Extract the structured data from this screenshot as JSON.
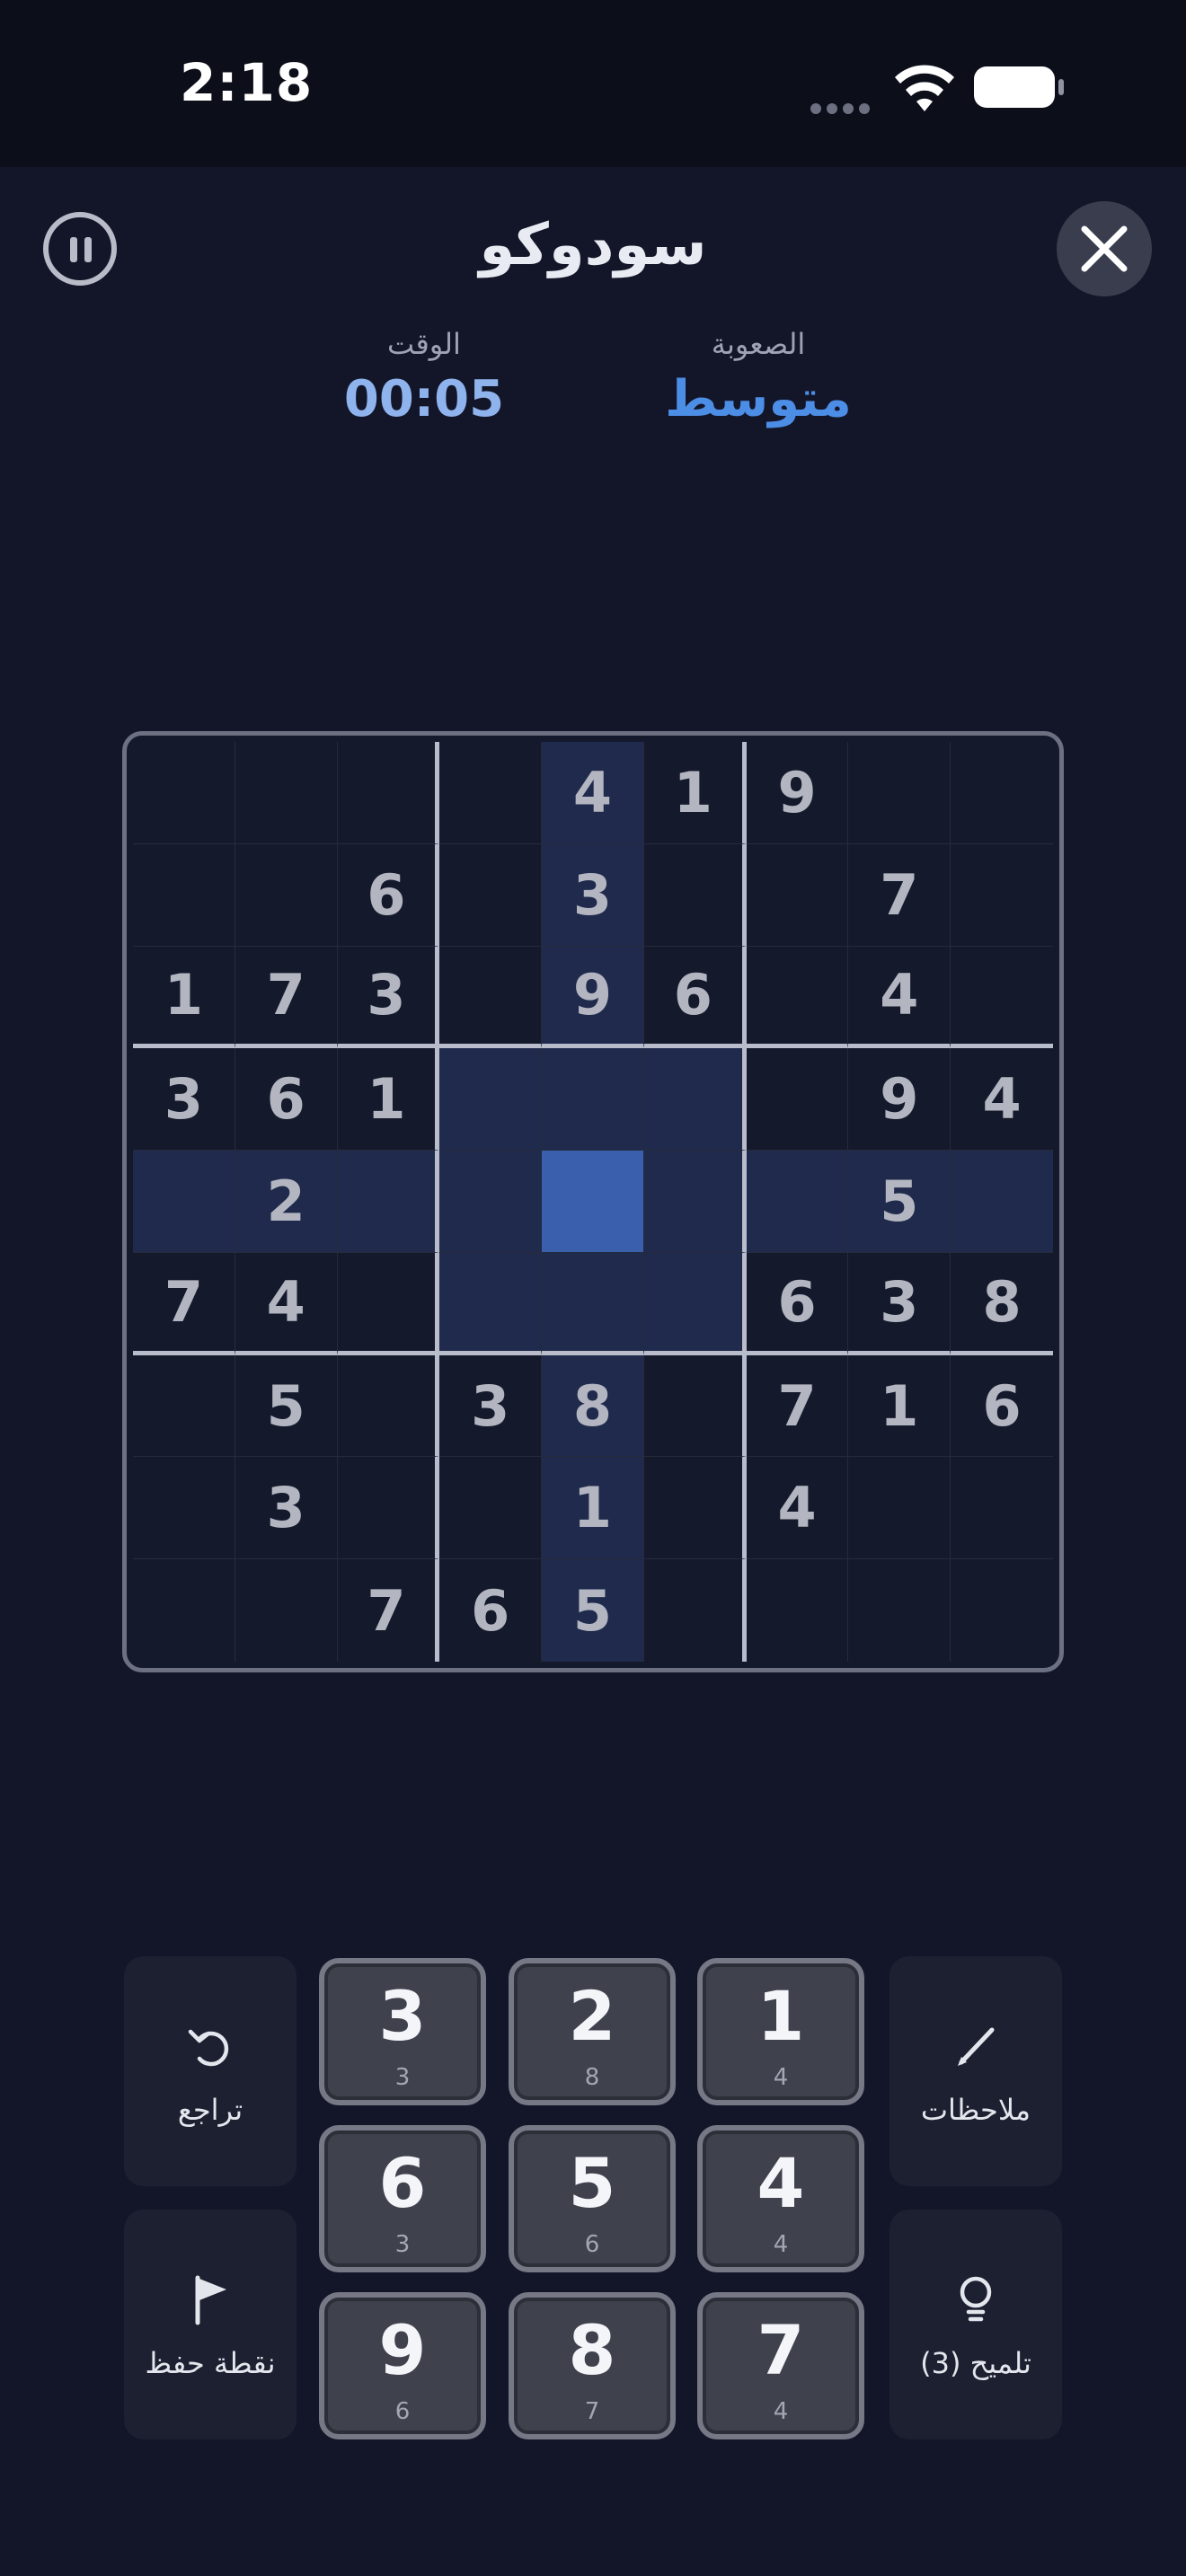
{
  "status_bar": {
    "time": "2:18"
  },
  "header": {
    "title": "سودوكو"
  },
  "stats": {
    "time_label": "الوقت",
    "time_value": "00:05",
    "difficulty_label": "الصعوبة",
    "difficulty_value": "متوسط"
  },
  "board": {
    "selected": {
      "row": 5,
      "col": 5
    },
    "rows": [
      [
        "",
        "",
        "",
        "",
        "4",
        "1",
        "9",
        "",
        ""
      ],
      [
        "",
        "",
        "6",
        "",
        "3",
        "",
        "",
        "7",
        ""
      ],
      [
        "1",
        "7",
        "3",
        "",
        "9",
        "6",
        "",
        "4",
        ""
      ],
      [
        "3",
        "6",
        "1",
        "",
        "",
        "",
        "",
        "9",
        "4"
      ],
      [
        "",
        "2",
        "",
        "",
        "",
        "",
        "",
        "5",
        ""
      ],
      [
        "7",
        "4",
        "",
        "",
        "",
        "",
        "6",
        "3",
        "8"
      ],
      [
        "",
        "5",
        "",
        "3",
        "8",
        "",
        "7",
        "1",
        "6"
      ],
      [
        "",
        "3",
        "",
        "",
        "1",
        "",
        "4",
        "",
        ""
      ],
      [
        "",
        "",
        "7",
        "6",
        "5",
        "",
        "",
        "",
        ""
      ]
    ]
  },
  "actions": {
    "undo_label": "تراجع",
    "save_label": "نقطة حفظ",
    "notes_label": "ملاحظات",
    "hint_label": "تلميح (3)"
  },
  "keypad": [
    {
      "digit": "3",
      "count": "3"
    },
    {
      "digit": "2",
      "count": "8"
    },
    {
      "digit": "1",
      "count": "4"
    },
    {
      "digit": "6",
      "count": "3"
    },
    {
      "digit": "5",
      "count": "6"
    },
    {
      "digit": "4",
      "count": "4"
    },
    {
      "digit": "9",
      "count": "6"
    },
    {
      "digit": "8",
      "count": "7"
    },
    {
      "digit": "7",
      "count": "4"
    }
  ],
  "colors": {
    "background": "#131629",
    "accent": "#4c8de6",
    "selected_cell": "#3a5fac",
    "highlight_cell": "#1f2a4c"
  }
}
